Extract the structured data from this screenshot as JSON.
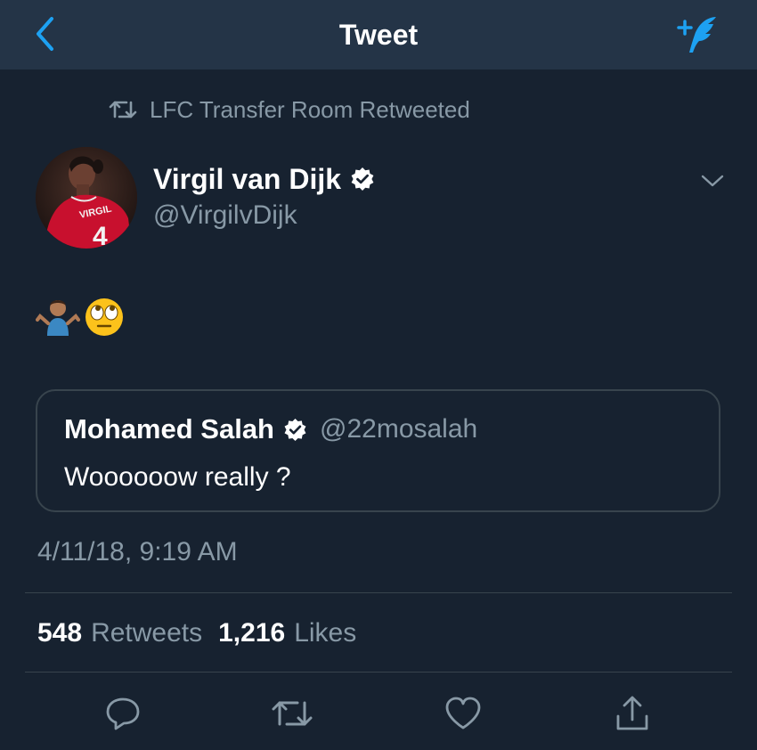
{
  "nav": {
    "title": "Tweet",
    "back_icon": "chevron-left-icon",
    "compose_icon": "compose-quill-icon",
    "accent_color": "#1da1f2"
  },
  "retweet_context": {
    "icon": "retweet-icon",
    "text": "LFC Transfer Room Retweeted"
  },
  "author": {
    "name": "Virgil van Dijk",
    "handle": "@VirgilvDijk",
    "verified": true,
    "avatar_jersey_name": "VIRGIL",
    "avatar_jersey_number": "4"
  },
  "tweet": {
    "emojis": [
      "🤷🏽‍♂️",
      "🙄"
    ]
  },
  "quoted_tweet": {
    "name": "Mohamed Salah",
    "handle": "@22mosalah",
    "verified": true,
    "text": "Woooooow really ?"
  },
  "timestamp": "4/11/18, 9:19 AM",
  "stats": {
    "retweets_count": "548",
    "retweets_label": "Retweets",
    "likes_count": "1,216",
    "likes_label": "Likes"
  },
  "actions": [
    "reply-icon",
    "retweet-icon",
    "like-icon",
    "share-icon"
  ],
  "colors": {
    "background": "#172230",
    "navbar": "#243447",
    "secondary_text": "#8899a6",
    "divider": "#38444d"
  }
}
